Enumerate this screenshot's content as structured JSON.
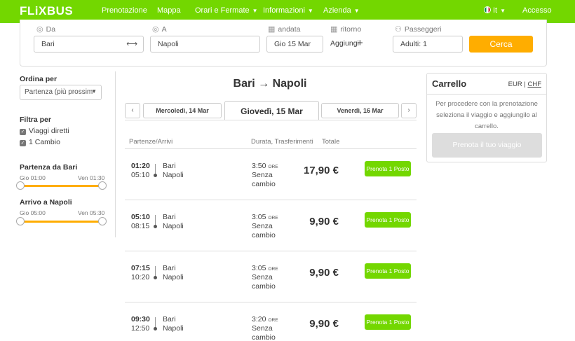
{
  "nav": {
    "logo": "FLiXBUS",
    "items": [
      {
        "label": "Prenotazione",
        "dropdown": false
      },
      {
        "label": "Mappa",
        "dropdown": false
      },
      {
        "label": "Orari e Fermate",
        "dropdown": true
      },
      {
        "label": "Informazioni",
        "dropdown": true
      },
      {
        "label": "Azienda",
        "dropdown": true
      }
    ],
    "language": "It",
    "login": "Accesso",
    "brand_color": "#73d700"
  },
  "search": {
    "from_label": "Da",
    "from_value": "Bari",
    "swap_icon": "⟷",
    "to_label": "A",
    "to_value": "Napoli",
    "depart_label": "andata",
    "depart_value": "Gio 15 Mar",
    "return_label": "ritorno",
    "return_value": "Aggiungi",
    "passengers_label": "Passeggeri",
    "passengers_value": "Adulti: 1",
    "search_button": "Cerca",
    "button_color": "#ffad00"
  },
  "sidebar": {
    "sort_title": "Ordina per",
    "sort_value": "Partenza (più prossim",
    "filter_title": "Filtra per",
    "filters": [
      {
        "label": "Viaggi diretti",
        "checked": true
      },
      {
        "label": "1 Cambio",
        "checked": true
      }
    ],
    "departure": {
      "title": "Partenza da Bari",
      "min": "Gio 01:00",
      "max": "Ven 01:30"
    },
    "arrival": {
      "title": "Arrivo a Napoli",
      "min": "Gio 05:00",
      "max": "Ven 05:30"
    }
  },
  "results": {
    "title": "Bari → Napoli",
    "prev_day": "Mercoledì, 14 Mar",
    "current_day": "Giovedì, 15 Mar",
    "next_day": "Venerdì, 16 Mar",
    "col_times": "Partenze/Arrivi",
    "col_duration": "Durata, Trasferimenti",
    "col_total": "Totale",
    "rows": [
      {
        "dep": "01:20",
        "arr": "05:10",
        "from": "Bari",
        "to": "Napoli",
        "duration": "3:50",
        "unit": "ORE",
        "transfer": "Senza cambio",
        "price": "17,90 €",
        "button": "Prenota 1 Posto"
      },
      {
        "dep": "05:10",
        "arr": "08:15",
        "from": "Bari",
        "to": "Napoli",
        "duration": "3:05",
        "unit": "ORE",
        "transfer": "Senza cambio",
        "price": "9,90 €",
        "button": "Prenota 1 Posto"
      },
      {
        "dep": "07:15",
        "arr": "10:20",
        "from": "Bari",
        "to": "Napoli",
        "duration": "3:05",
        "unit": "ORE",
        "transfer": "Senza cambio",
        "price": "9,90 €",
        "button": "Prenota 1 Posto"
      },
      {
        "dep": "09:30",
        "arr": "12:50",
        "from": "Bari",
        "to": "Napoli",
        "duration": "3:20",
        "unit": "ORE",
        "transfer": "Senza cambio",
        "price": "9,90 €",
        "button": "Prenota 1 Posto"
      }
    ]
  },
  "cart": {
    "title": "Carrello",
    "currency_eur": "EUR",
    "currency_sep": "|",
    "currency_chf": "CHF",
    "message": "Per procedere con la prenotazione seleziona il viaggio e aggiungilo al carrello.",
    "button": "Prenota il tuo viaggio"
  }
}
